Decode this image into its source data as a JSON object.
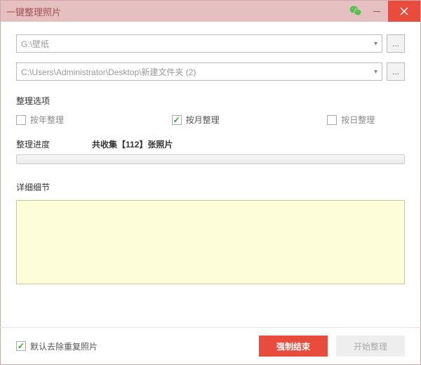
{
  "title": "一键整理照片",
  "source_path": "G:\\壁纸",
  "dest_path": "C:\\Users\\Administrator\\Desktop\\新建文件夹 (2)",
  "section_options_label": "整理选项",
  "options": {
    "by_year": {
      "label": "按年整理",
      "checked": false
    },
    "by_month": {
      "label": "按月整理",
      "checked": true
    },
    "by_day": {
      "label": "按日整理",
      "checked": false
    }
  },
  "progress": {
    "label": "整理进度",
    "status": "共收集【112】张照片"
  },
  "detail_label": "详细细节",
  "footer": {
    "dedupe": {
      "label": "默认去除重复照片",
      "checked": true
    },
    "force_stop": "强制结束",
    "start": "开始整理"
  },
  "browse_glyph": "..."
}
